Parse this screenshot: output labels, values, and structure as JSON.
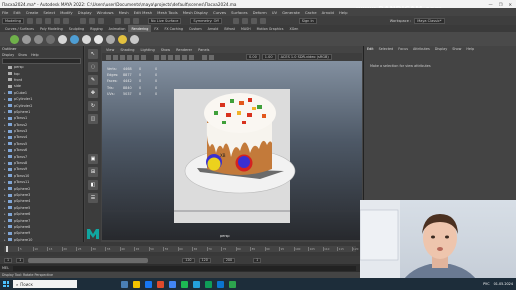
{
  "window": {
    "title": "Пасха2024.ma* - Autodesk MAYA 2022: C:\\Users\\user\\Documents\\maya\\projects\\default\\scenes\\Пасха2024.ma",
    "controls": [
      "—",
      "❐",
      "✕"
    ]
  },
  "watermark": {
    "brand": "www.BANDICAM.com"
  },
  "menubar": [
    "File",
    "Edit",
    "Create",
    "Select",
    "Modify",
    "Display",
    "Windows",
    "Mesh",
    "Edit Mesh",
    "Mesh Tools",
    "Mesh Display",
    "Curves",
    "Surfaces",
    "Deform",
    "UV",
    "Generate",
    "Cache",
    "Arnold",
    "Help"
  ],
  "statusline": {
    "mode": "Modeling",
    "no_live": "No Live Surface",
    "symmetry": "Symmetry: Off",
    "sign_in": "Sign In",
    "workspace_label": "Workspace :",
    "workspace_value": "Maya Classic*"
  },
  "shelf_tabs": {
    "items": [
      "Curves / Surfaces",
      "Poly Modeling",
      "Sculpting",
      "Rigging",
      "Animation",
      "Rendering",
      "FX",
      "FX Caching",
      "Custom",
      "Arnold",
      "Bifrost",
      "MASH",
      "Motion Graphics",
      "XGen"
    ],
    "active_index": 5
  },
  "shelf_icon_colors": [
    "#6fb04a",
    "#9b9b9b",
    "#8c8c8c",
    "#6f6f6f",
    "#d6d6d6",
    "#4e9ed4",
    "#d9d9d9",
    "#e6e6e6",
    "#aaaaaa",
    "#e3c13f",
    "#c9c9c9"
  ],
  "outliner": {
    "title": "Outliner",
    "menu": [
      "Display",
      "Show",
      "Help"
    ],
    "items": [
      "persp",
      "top",
      "front",
      "side",
      "pCube1",
      "pCylinder1",
      "pCylinder2",
      "pSphere1",
      "pTorus1",
      "pTorus2",
      "pTorus3",
      "pTorus4",
      "pTorus5",
      "pTorus6",
      "pTorus7",
      "pTorus8",
      "pTorus9",
      "pTorus10",
      "pTorus11",
      "pSphere2",
      "pSphere3",
      "pSphere4",
      "pSphere5",
      "pSphere6",
      "pSphere7",
      "pSphere8",
      "pSphere9",
      "pSphere10",
      "pSphere11"
    ]
  },
  "viewport": {
    "menu": [
      "View",
      "Shading",
      "Lighting",
      "Show",
      "Renderer",
      "Panels"
    ],
    "hud": {
      "rows": [
        {
          "label": "Verts:",
          "a": "4468",
          "b": "0",
          "c": "0"
        },
        {
          "label": "Edges:",
          "a": "8877",
          "b": "0",
          "c": "0"
        },
        {
          "label": "Faces:",
          "a": "4442",
          "b": "0",
          "c": "0"
        },
        {
          "label": "Tris:",
          "a": "8840",
          "b": "0",
          "c": "0"
        },
        {
          "label": "UVs:",
          "a": "5037",
          "b": "0",
          "c": "0"
        }
      ]
    },
    "camera": "persp",
    "near_clip": "0.00",
    "far_clip": "1.00",
    "color_space": "ACES 1.0 SDR-video (sRGB)",
    "egg_label": "XB"
  },
  "right_panel": {
    "tabs": [
      "Edit",
      "Selected",
      "Focus",
      "Attributes",
      "Display",
      "Show",
      "Help"
    ],
    "message": "Make a selection for view attributes"
  },
  "timeslider": {
    "ticks": [
      "5",
      "10",
      "15",
      "20",
      "25",
      "30",
      "35",
      "40",
      "45",
      "50",
      "55",
      "60",
      "65",
      "70",
      "75",
      "80",
      "85",
      "90",
      "95",
      "100",
      "105",
      "110",
      "115",
      "120"
    ],
    "current_frame": "1"
  },
  "range": {
    "start": "1",
    "inner_start": "1",
    "inner_end": "120",
    "end": "120",
    "end2": "200"
  },
  "mel": {
    "label": "MEL"
  },
  "help_line": "Display Tool: Rotate Perspective",
  "taskbar": {
    "search_placeholder": "Поиск",
    "app_colors": [
      "#4a7fb5",
      "#f2c200",
      "#1877f2",
      "#e04a2c",
      "#4285f4",
      "#1db954",
      "#24a1de",
      "#0f9d58",
      "#0b74d0",
      "#2da44e"
    ],
    "language": "РУС",
    "time": "01.05.2024"
  },
  "colors": {
    "accent_blue": "#4e9ed4",
    "maya_logo": "#10a6a0",
    "viewport_top": "#8390a0",
    "viewport_bottom": "#27292d"
  }
}
